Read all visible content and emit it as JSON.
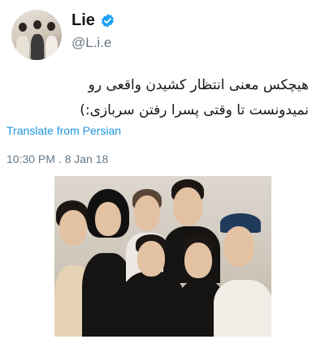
{
  "user": {
    "display_name": "Lie",
    "handle": "@L.i.e",
    "verified": true
  },
  "tweet": {
    "text_lines": [
      "هیچکس معنی انتظار کشیدن واقعی رو",
      "نمیدونست تا وقتی پسرا رفتن سربازی:)"
    ],
    "translate_label": "Translate from Persian",
    "timestamp": "10:30 PM . 8 Jan 18"
  },
  "colors": {
    "link": "#1b95e0",
    "secondary_text": "#657786",
    "verified_badge": "#1da1f2"
  },
  "icons": {
    "verified": "verified-badge-icon"
  }
}
